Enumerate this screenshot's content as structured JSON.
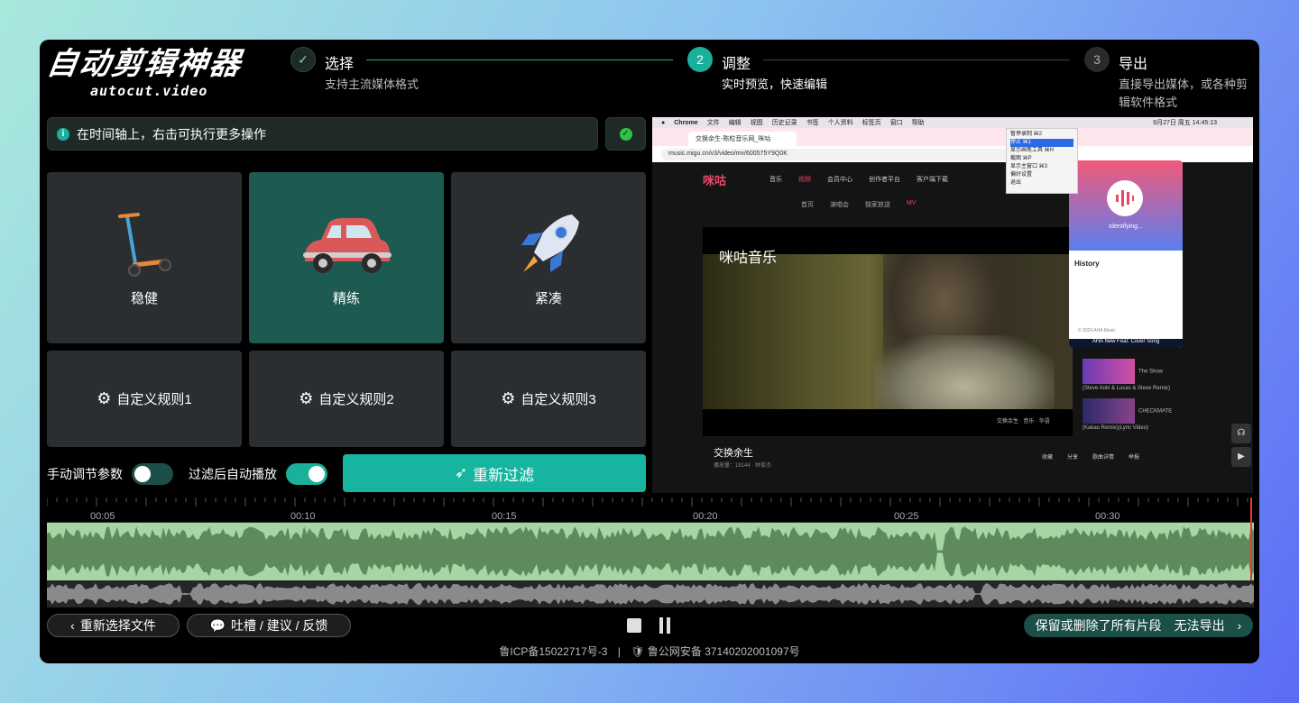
{
  "logo": {
    "title": "自动剪辑神器",
    "subtitle": "autocut.video"
  },
  "steps": [
    {
      "num": "✓",
      "title": "选择",
      "desc": "支持主流媒体格式"
    },
    {
      "num": "2",
      "title": "调整",
      "desc": "实时预览，快速编辑"
    },
    {
      "num": "3",
      "title": "导出",
      "desc": "直接导出媒体，或各种剪辑软件格式"
    }
  ],
  "tip": {
    "text": "在时间轴上，右击可执行更多操作"
  },
  "modes": [
    {
      "label": "稳健"
    },
    {
      "label": "精练"
    },
    {
      "label": "紧凑"
    }
  ],
  "rules": [
    {
      "label": "自定义规则1"
    },
    {
      "label": "自定义规则2"
    },
    {
      "label": "自定义规则3"
    }
  ],
  "controls": {
    "manual_label": "手动调节参数",
    "manual_on": false,
    "autoplay_label": "过滤后自动播放",
    "autoplay_on": true,
    "refilter_label": "重新过滤"
  },
  "preview": {
    "menubar": [
      "Chrome",
      "文件",
      "编辑",
      "视图",
      "历史记录",
      "书签",
      "个人资料",
      "标签页",
      "窗口",
      "帮助"
    ],
    "menubar_right": "9月27日 周五 14:45:13",
    "tab_title": "交换余生-陈粒音乐网_咪咕",
    "url": "music.migu.cn/v3/video/mv/600575Y9Q0K",
    "site_logo": "咪咕",
    "nav": [
      "音乐",
      "视频",
      "会员中心",
      "创作者平台",
      "客户端下载"
    ],
    "subnav": [
      "首页",
      "演唱会",
      "独家放送",
      "MV"
    ],
    "watermark": "咪咕音乐",
    "caption": "交换余生 · 音乐 · 华语",
    "song_title": "交换余生",
    "song_meta": "播放量：18144 · 林俊杰",
    "actions": [
      "收藏",
      "分享",
      "歌曲详情",
      "举报"
    ],
    "recommend": [
      "The Show (Steve Aoki & Lucas & Steve Remix)",
      "CHECKMATE (Kakao Remix)(Lyric Video)"
    ],
    "popup": {
      "status": "Identifying...",
      "history": "History",
      "footer": "© 2024 AHA Music",
      "bar": "AHA New Feat: Cover Song"
    },
    "menu": [
      "暂停录制 ⌘2",
      "停止 ⌘1",
      "显示画笔工具 ⌘H",
      "截图 ⌘P",
      "显示主窗口 ⌘3",
      "偏好设置",
      "退出"
    ]
  },
  "timeline": {
    "ticks": [
      "00:05",
      "00:10",
      "00:15",
      "00:20",
      "00:25",
      "00:30"
    ]
  },
  "bottom": {
    "back_label": "重新选择文件",
    "feedback_label": "吐槽 / 建议 / 反馈",
    "export_status": "保留或删除了所有片段",
    "export_label": "无法导出"
  },
  "footer": {
    "icp": "鲁ICP备15022717号-3",
    "police": "鲁公网安备 37140202001097号"
  },
  "colors": {
    "accent": "#1ab09c",
    "selected_card": "#1d5b52",
    "card": "#2b2e30",
    "waveform": "#a7d6a5"
  }
}
